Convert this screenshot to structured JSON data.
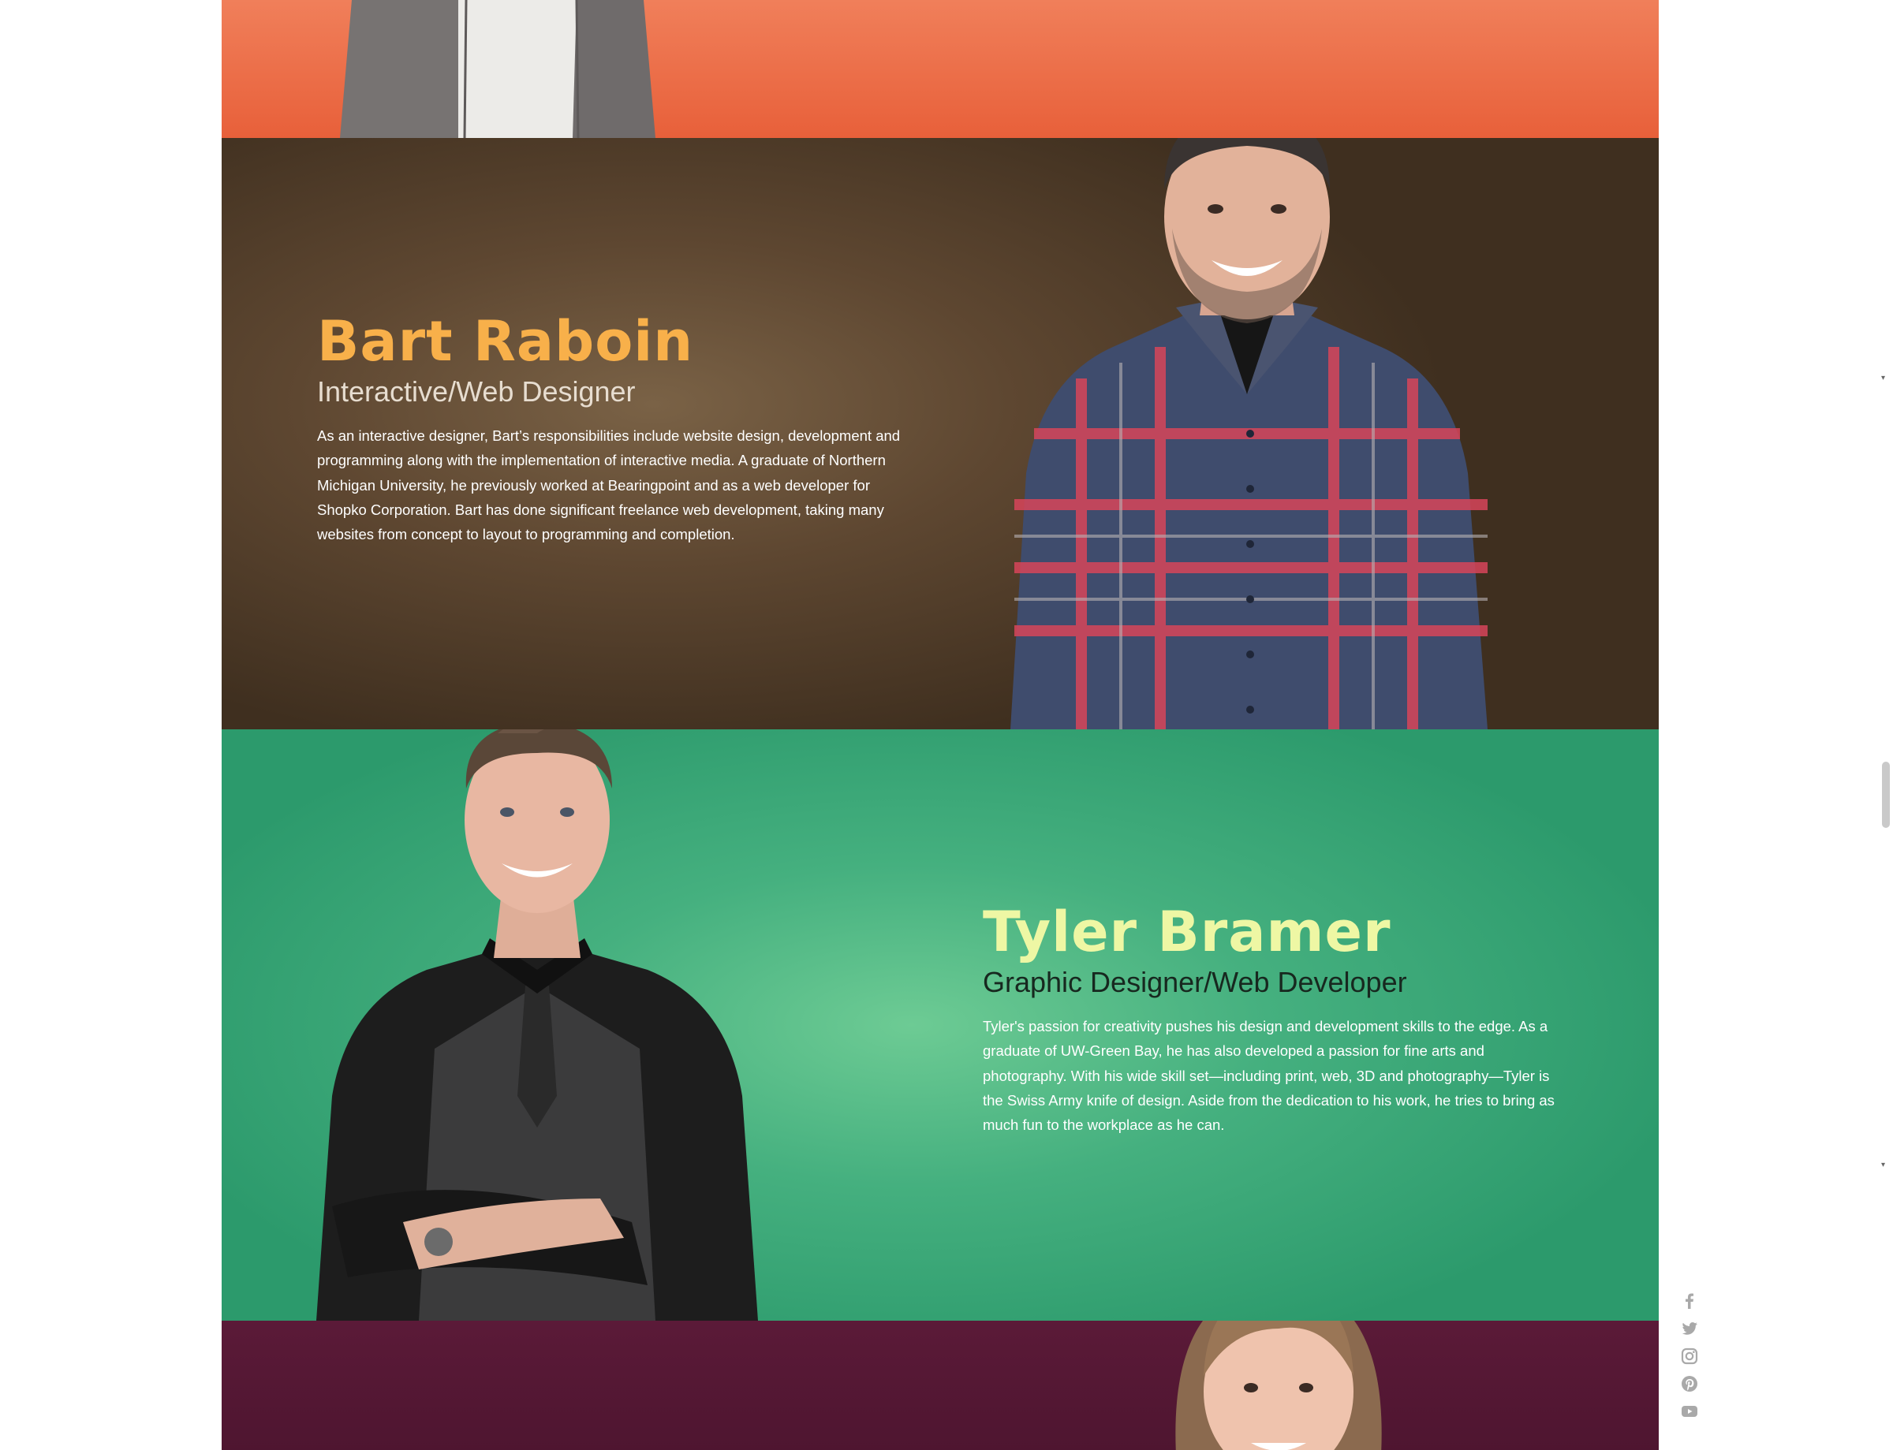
{
  "profiles": [
    {
      "name": "Bart Raboin",
      "role": "Interactive/Web Designer",
      "bio": "As an interactive designer, Bart’s responsibilities include website design, development and programming along with the implementation of interactive media. A graduate of Northern Michigan University, he previously worked at Bearingpoint and as a web developer for Shopko Corporation. Bart has done significant freelance web development, taking many websites from concept to layout to programming and completion."
    },
    {
      "name": "Tyler Bramer",
      "role": "Graphic Designer/Web Developer",
      "bio": "Tyler's passion for creativity pushes his design and development skills to the edge. As a graduate of UW-Green Bay, he has also developed a passion for fine arts and photography. With his wide skill set—including print, web, 3D and photography—Tyler is the Swiss Army knife of design. Aside from the dedication to his work, he tries to bring as much fun to the workplace as he can."
    }
  ],
  "colors": {
    "orange_band": "#ec6c45",
    "brown_band": "#5e4731",
    "green_band": "#45b07f",
    "maroon_band": "#5b1a38",
    "bart_name": "#f8b04a",
    "tyler_name": "#eef7a4"
  },
  "social_icons": [
    "facebook-icon",
    "twitter-icon",
    "instagram-icon",
    "pinterest-icon",
    "youtube-icon"
  ]
}
